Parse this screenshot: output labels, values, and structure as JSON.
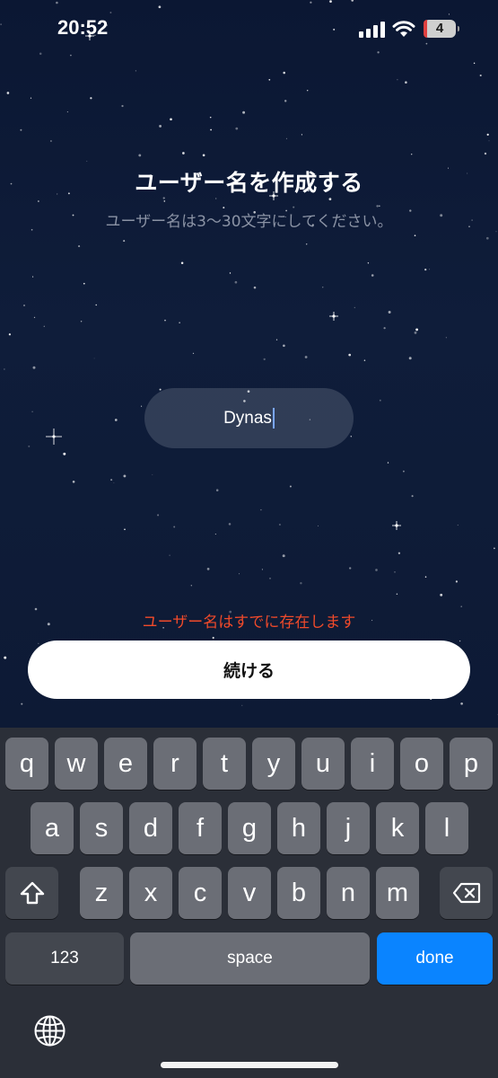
{
  "status_bar": {
    "time": "20:52",
    "battery_level": "4"
  },
  "screen": {
    "title": "ユーザー名を作成する",
    "subtitle": "ユーザー名は3〜30文字にしてください。",
    "username_value": "Dynas",
    "error_message": "ユーザー名はすでに存在します",
    "continue_label": "続ける",
    "error_color": "#f04a2a"
  },
  "keyboard": {
    "row1": [
      "q",
      "w",
      "e",
      "r",
      "t",
      "y",
      "u",
      "i",
      "o",
      "p"
    ],
    "row2": [
      "a",
      "s",
      "d",
      "f",
      "g",
      "h",
      "j",
      "k",
      "l"
    ],
    "row3": [
      "z",
      "x",
      "c",
      "v",
      "b",
      "n",
      "m"
    ],
    "numbers_label": "123",
    "space_label": "space",
    "done_label": "done",
    "done_color": "#0a84ff"
  }
}
